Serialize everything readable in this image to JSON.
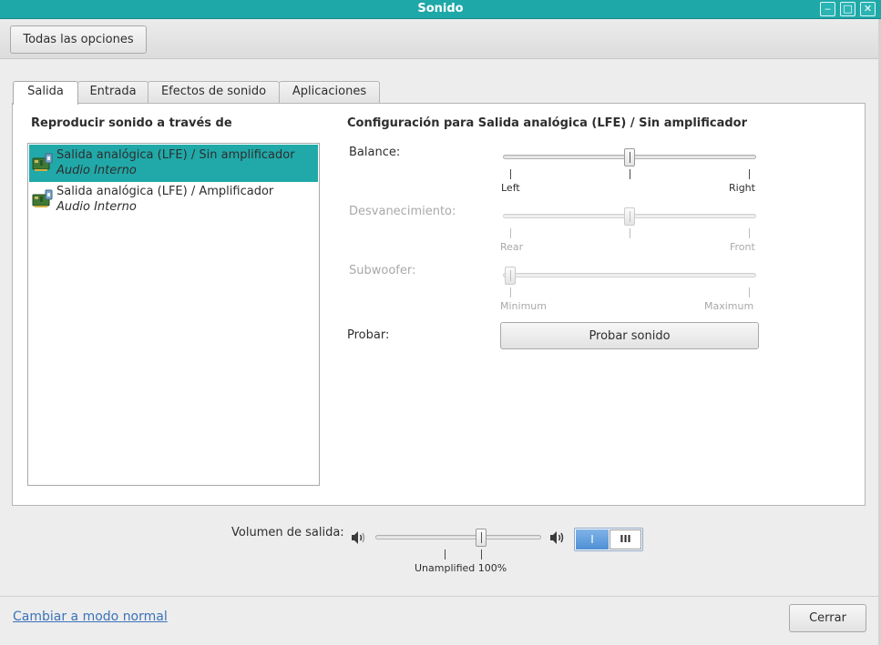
{
  "window": {
    "title": "Sonido",
    "controls": [
      "minimize-icon",
      "maximize-icon",
      "close-icon"
    ]
  },
  "toolbar": {
    "all_settings_label": "Todas las opciones"
  },
  "tabs": [
    {
      "label": "Salida",
      "active": true
    },
    {
      "label": "Entrada",
      "active": false
    },
    {
      "label": "Efectos de sonido",
      "active": false
    },
    {
      "label": "Aplicaciones",
      "active": false
    }
  ],
  "output": {
    "devices_heading": "Reproducir sonido a través de",
    "devices": [
      {
        "name": "Salida analógica (LFE) / Sin amplificador",
        "subtitle": "Audio Interno",
        "selected": true,
        "icon": "audio-card-icon"
      },
      {
        "name": "Salida analógica (LFE) / Amplificador",
        "subtitle": "Audio Interno",
        "selected": false,
        "icon": "audio-card-icon"
      }
    ],
    "settings_heading": "Configuración para Salida analógica (LFE) / Sin amplificador",
    "balance": {
      "label": "Balance:",
      "left": "Left",
      "right": "Right",
      "value": 0.5,
      "enabled": true
    },
    "fade": {
      "label": "Desvanecimiento:",
      "left": "Rear",
      "right": "Front",
      "value": 0.5,
      "enabled": false
    },
    "subwoofer": {
      "label": "Subwoofer:",
      "left": "Minimum",
      "right": "Maximum",
      "value": 0.0,
      "enabled": false
    },
    "test": {
      "label": "Probar:",
      "button": "Probar sonido"
    }
  },
  "volume": {
    "label": "Volumen de salida:",
    "mark_label": "Unamplified 100%",
    "value_percent": 100,
    "max_percent": 153,
    "low_icon": "speaker-low-icon",
    "high_icon": "speaker-high-icon",
    "toggle_on": "I",
    "toggle_off": "III"
  },
  "footer": {
    "mode_link": "Cambiar a modo normal",
    "close_label": "Cerrar"
  },
  "colors": {
    "titlebar": "#1fa8a8",
    "selection": "#21a9a9",
    "link": "#3b73b9",
    "toggle_on": "#4f90d4"
  }
}
